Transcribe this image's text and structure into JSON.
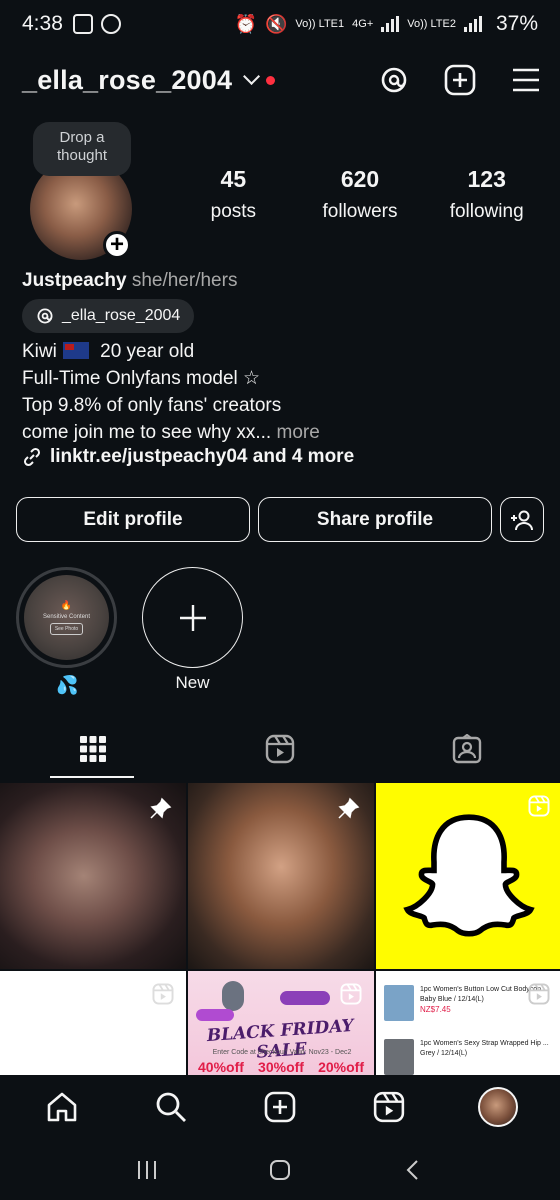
{
  "status_bar": {
    "time": "4:38",
    "network1": "Vo)) LTE1",
    "network_type": "4G+",
    "network2": "Vo)) LTE2",
    "battery": "37%"
  },
  "header": {
    "username": "_ella_rose_2004"
  },
  "note": {
    "text": "Drop a thought"
  },
  "stats": [
    {
      "value": "45",
      "label": "posts"
    },
    {
      "value": "620",
      "label": "followers"
    },
    {
      "value": "123",
      "label": "following"
    }
  ],
  "profile": {
    "name": "Justpeachy",
    "pronouns": "she/her/hers",
    "threads_handle": "_ella_rose_2004",
    "bio_line1_a": "Kiwi",
    "bio_line1_b": "20 year old",
    "bio_line2": "Full-Time Onlyfans model ☆",
    "bio_line3": "Top 9.8% of only fans' creators",
    "bio_line4": "come join me to see why xx...",
    "bio_more": "more",
    "link": "linktr.ee/justpeachy04 and 4 more"
  },
  "buttons": {
    "edit": "Edit profile",
    "share": "Share profile"
  },
  "highlights": [
    {
      "label": "💦",
      "content_warning": "Sensitive Content",
      "see_photo": "See Photo"
    },
    {
      "label": "New"
    }
  ],
  "grid": {
    "black_friday": {
      "title": "BLACK FRIDAY SALE",
      "subtitle": "Enter Code at checkout!    Valid: Nov23 - Dec2",
      "p1": "40%off",
      "p2": "30%off",
      "p3": "20%off"
    },
    "shop": {
      "item1": "1pc Women's Button Low Cut Bodycon",
      "item1_color": "Baby Blue / 12/14(L)",
      "item1_price": "NZ$7.45",
      "item2": "1pc Women's Sexy Strap Wrapped Hip ...",
      "item2_color": "Grey / 12/14(L)"
    }
  },
  "colors": {
    "background": "#0c1014",
    "notification_dot": "#ff3040",
    "snapchat_yellow": "#fffc00",
    "link_blue": "#5ab0ff"
  }
}
